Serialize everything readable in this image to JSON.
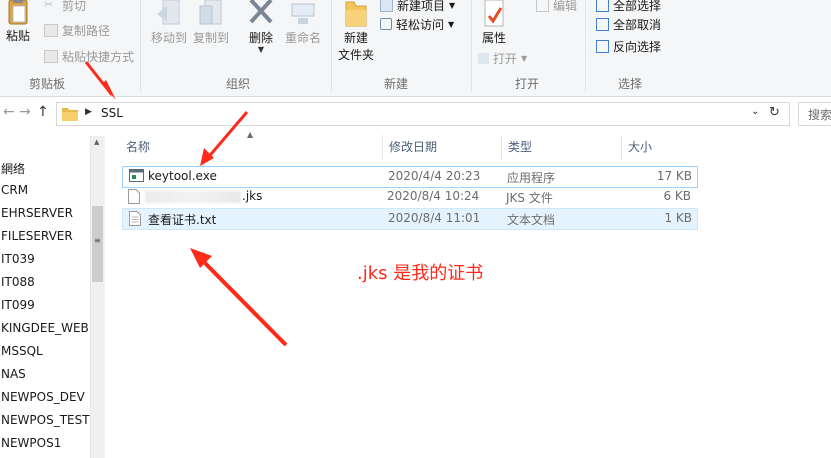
{
  "ribbon": {
    "clipboard": {
      "paste": "粘贴",
      "cut": "剪切",
      "copy_path": "复制路径",
      "paste_shortcut": "粘贴快捷方式",
      "group": "剪贴板"
    },
    "organize": {
      "move_to": "移动到",
      "copy_to": "复制到",
      "delete": "删除",
      "rename": "重命名",
      "group": "组织"
    },
    "new": {
      "new_folder_line1": "新建",
      "new_folder_line2": "文件夹",
      "new_item": "新建项目",
      "easy_access": "轻松访问",
      "group": "新建"
    },
    "open": {
      "properties": "属性",
      "open": "打开",
      "edit": "编辑",
      "group": "打开"
    },
    "select": {
      "select_all": "全部选择",
      "select_none": "全部取消",
      "invert": "反向选择",
      "group": "选择"
    }
  },
  "address": {
    "crumb": "SSL",
    "search_placeholder": "搜索"
  },
  "nav": {
    "items": [
      "網络",
      "CRM",
      "EHRSERVER",
      "FILESERVER",
      "IT039",
      "IT088",
      "IT099",
      "KINGDEE_WEB",
      "MSSQL",
      "NAS",
      "NEWPOS_DEV",
      "NEWPOS_TEST",
      "NEWPOS1"
    ]
  },
  "columns": {
    "name": "名称",
    "date": "修改日期",
    "type": "类型",
    "size": "大小"
  },
  "files": [
    {
      "name": "keytool.exe",
      "date": "2020/4/4 20:23",
      "type": "应用程序",
      "size": "17 KB"
    },
    {
      "name": ".jks",
      "date": "2020/8/4 10:24",
      "type": "JKS 文件",
      "size": "6 KB"
    },
    {
      "name": "查看证书.txt",
      "date": "2020/8/4 11:01",
      "type": "文本文档",
      "size": "1 KB"
    }
  ],
  "annotation": ".jks 是我的证书",
  "colors": {
    "accent": "#ff2a1a",
    "selection": "#99d1ff",
    "hover": "#e5f3ff"
  }
}
